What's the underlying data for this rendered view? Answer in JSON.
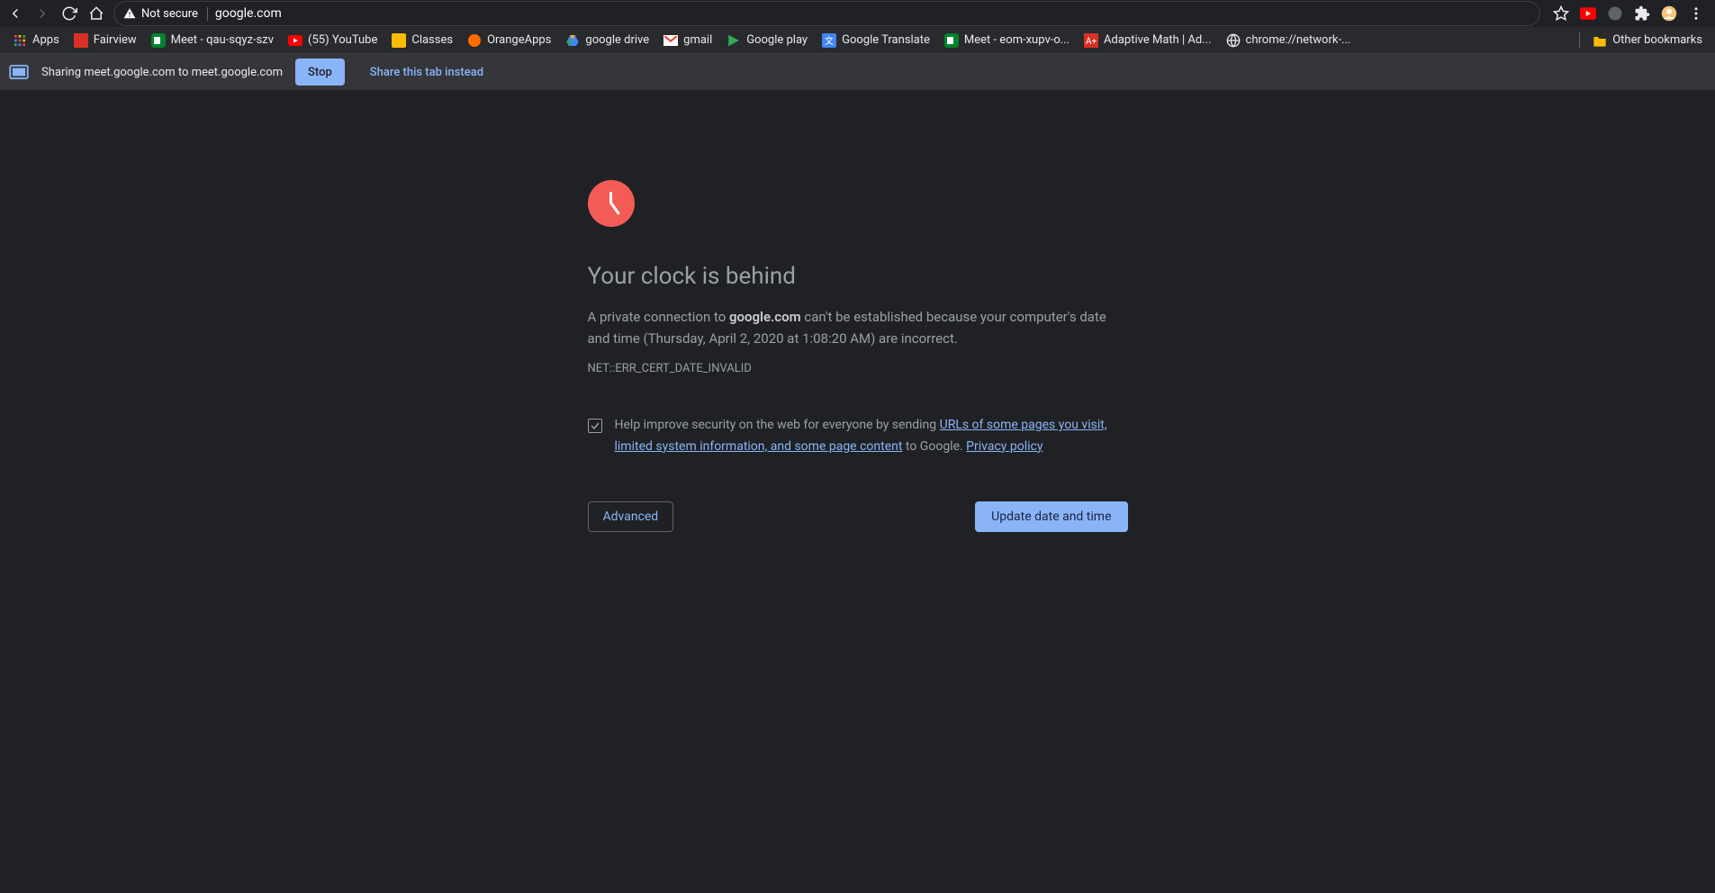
{
  "toolbar": {
    "security_label": "Not secure",
    "url": "google.com"
  },
  "bookmarks": {
    "items": [
      {
        "label": "Apps"
      },
      {
        "label": "Fairview"
      },
      {
        "label": "Meet - qau-sqyz-szv"
      },
      {
        "label": "(55) YouTube"
      },
      {
        "label": "Classes"
      },
      {
        "label": "OrangeApps"
      },
      {
        "label": "google drive"
      },
      {
        "label": "gmail"
      },
      {
        "label": "Google play"
      },
      {
        "label": "Google Translate"
      },
      {
        "label": "Meet - eom-xupv-o..."
      },
      {
        "label": "Adaptive Math | Ad..."
      },
      {
        "label": "chrome://network-..."
      }
    ],
    "other": "Other bookmarks"
  },
  "share": {
    "text": "Sharing meet.google.com to meet.google.com",
    "stop": "Stop",
    "instead": "Share this tab instead"
  },
  "page": {
    "heading": "Your clock is behind",
    "msg_pre": "A private connection to ",
    "msg_host": "google.com",
    "msg_post": " can't be established because your computer's date and time (Thursday, April 2, 2020 at 1:08:20 AM) are incorrect.",
    "error_code": "NET::ERR_CERT_DATE_INVALID",
    "opt_pre": "Help improve security on the web for everyone by sending ",
    "opt_link": "URLs of some pages you visit, limited system information, and some page content",
    "opt_post": " to Google. ",
    "privacy": "Privacy policy",
    "advanced": "Advanced",
    "update": "Update date and time"
  }
}
